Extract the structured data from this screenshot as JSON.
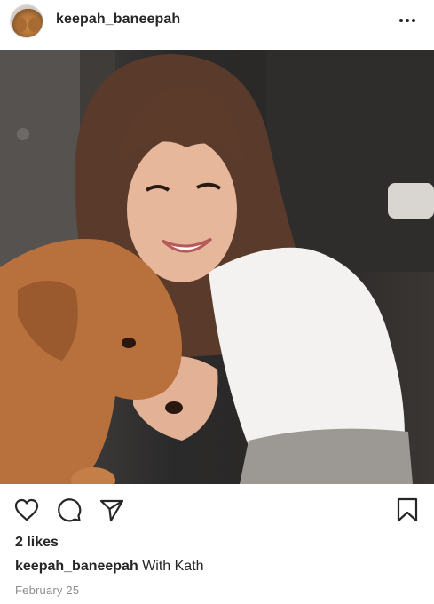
{
  "post": {
    "username": "keepah_baneepah",
    "likes": "2 likes",
    "caption_user": "keepah_baneepah",
    "caption_text": "With Kath",
    "date": "February 25"
  },
  "icons": {
    "more": "more-options-icon",
    "like": "heart-icon",
    "comment": "comment-icon",
    "share": "send-icon",
    "save": "bookmark-icon"
  }
}
